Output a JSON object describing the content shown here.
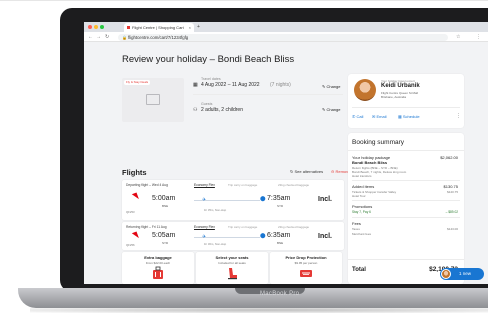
{
  "device": {
    "label": "MacBook Pro"
  },
  "browser": {
    "tab_title": "Flight Centre | Shopping Cart",
    "url": "flightcentre.com/cart/7/1234fgfg"
  },
  "page": {
    "title": "Review your holiday – Bondi Beach Bliss",
    "product_badge": "Fly & Stay Deals",
    "travel_dates_label": "Travel dates",
    "travel_dates_value": "4 Aug 2022 – 11 Aug 2022",
    "travel_nights": "(7 nights)",
    "guests_label": "Guests",
    "guests_value": "2 adults, 2 children",
    "change_label": "Change"
  },
  "flights": {
    "title": "Flights",
    "see_alternatives": "See alternatives",
    "remove": "Remove",
    "segments": [
      {
        "heading": "Departing flight – Wed 4 Aug",
        "fare": "Economy Flex",
        "carry_on": "Trip carry on baggage",
        "checked": "23kg checked baggage",
        "flight_no": "QF253",
        "depart_time": "5:00am",
        "depart_airport": "BNE",
        "duration": "1h 35m, Non-stop",
        "arrive_time": "7:35am",
        "arrive_airport": "SYD",
        "price": "Incl."
      },
      {
        "heading": "Returning flight – Fri 11 Aug",
        "fare": "Economy Flex",
        "carry_on": "Trip carry on baggage",
        "checked": "23kg checked baggage",
        "flight_no": "QF256",
        "depart_time": "5:05am",
        "depart_airport": "SYD",
        "duration": "1h 30m, Non-stop",
        "arrive_time": "6:35am",
        "arrive_airport": "BNE",
        "price": "Incl."
      }
    ]
  },
  "extras": [
    {
      "title": "Extra baggage",
      "subtitle": "From $22.00 each",
      "icon": "suitcase-icon"
    },
    {
      "title": "Select your seats",
      "subtitle": "Included for all seats",
      "icon": "seat-icon"
    },
    {
      "title": "Price Drop Protection",
      "subtitle": "$9.95 per person",
      "icon": "tag-icon"
    }
  ],
  "agent": {
    "role": "Your holiday travel expert",
    "name": "Keidi Urbanik",
    "address_line1": "Flight Centre Queen St Mall",
    "address_line2": "Brisbane, Australia",
    "call": "Call",
    "email": "Email",
    "schedule": "Schedule"
  },
  "summary": {
    "title": "Booking summary",
    "package_label": "Your holiday package",
    "package_name": "Bondi Beach Bliss",
    "package_price": "$2,062.00",
    "package_items": [
      "Return flights (BNE – SYD – BNE)",
      "Bondi Beach, 7 nights, Deluxe king room",
      "Hotel transfers"
    ],
    "added_label": "Added items",
    "added_price": "$130.75",
    "added_item": "Tickets & Shopper transfer Valley",
    "added_item_sub": "Hotel Tour",
    "added_item_price": "$120.75",
    "promo_label": "Promotions",
    "promo_item": "Stay 7, Pay 6",
    "promo_value": "– $89.02",
    "fees_label": "Fees",
    "fees_taxes": "Taxes",
    "fees_taxes_value": "$143.00",
    "fees_merchant": "Merchant fees",
    "total_label": "Total",
    "total_value": "$2,100.73"
  },
  "chat": {
    "label": "1 new"
  },
  "colors": {
    "accent": "#1976d2",
    "danger": "#e53935",
    "promo": "#2e7d32"
  }
}
